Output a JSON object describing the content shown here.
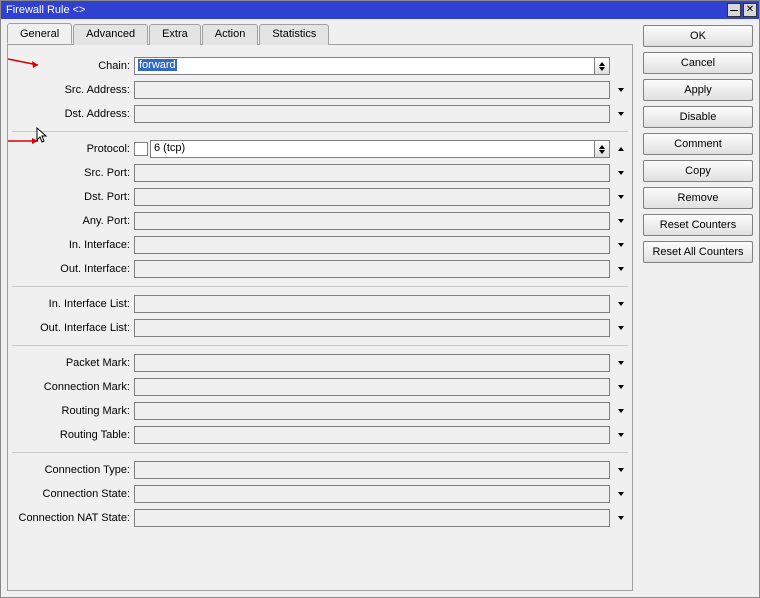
{
  "window": {
    "title": "Firewall Rule <>"
  },
  "tabs": {
    "general": "General",
    "advanced": "Advanced",
    "extra": "Extra",
    "action": "Action",
    "statistics": "Statistics"
  },
  "labels": {
    "chain": "Chain:",
    "src_address": "Src. Address:",
    "dst_address": "Dst. Address:",
    "protocol": "Protocol:",
    "src_port": "Src. Port:",
    "dst_port": "Dst. Port:",
    "any_port": "Any. Port:",
    "in_interface": "In. Interface:",
    "out_interface": "Out. Interface:",
    "in_interface_list": "In. Interface List:",
    "out_interface_list": "Out. Interface List:",
    "packet_mark": "Packet Mark:",
    "connection_mark": "Connection Mark:",
    "routing_mark": "Routing Mark:",
    "routing_table": "Routing Table:",
    "connection_type": "Connection Type:",
    "connection_state": "Connection State:",
    "connection_nat_state": "Connection NAT State:"
  },
  "values": {
    "chain": "forward",
    "src_address": "",
    "dst_address": "",
    "protocol": "6 (tcp)",
    "src_port": "",
    "dst_port": "",
    "any_port": "",
    "in_interface": "",
    "out_interface": "",
    "in_interface_list": "",
    "out_interface_list": "",
    "packet_mark": "",
    "connection_mark": "",
    "routing_mark": "",
    "routing_table": "",
    "connection_type": "",
    "connection_state": "",
    "connection_nat_state": ""
  },
  "buttons": {
    "ok": "OK",
    "cancel": "Cancel",
    "apply": "Apply",
    "disable": "Disable",
    "comment": "Comment",
    "copy": "Copy",
    "remove": "Remove",
    "reset_counters": "Reset Counters",
    "reset_all_counters": "Reset All Counters"
  }
}
